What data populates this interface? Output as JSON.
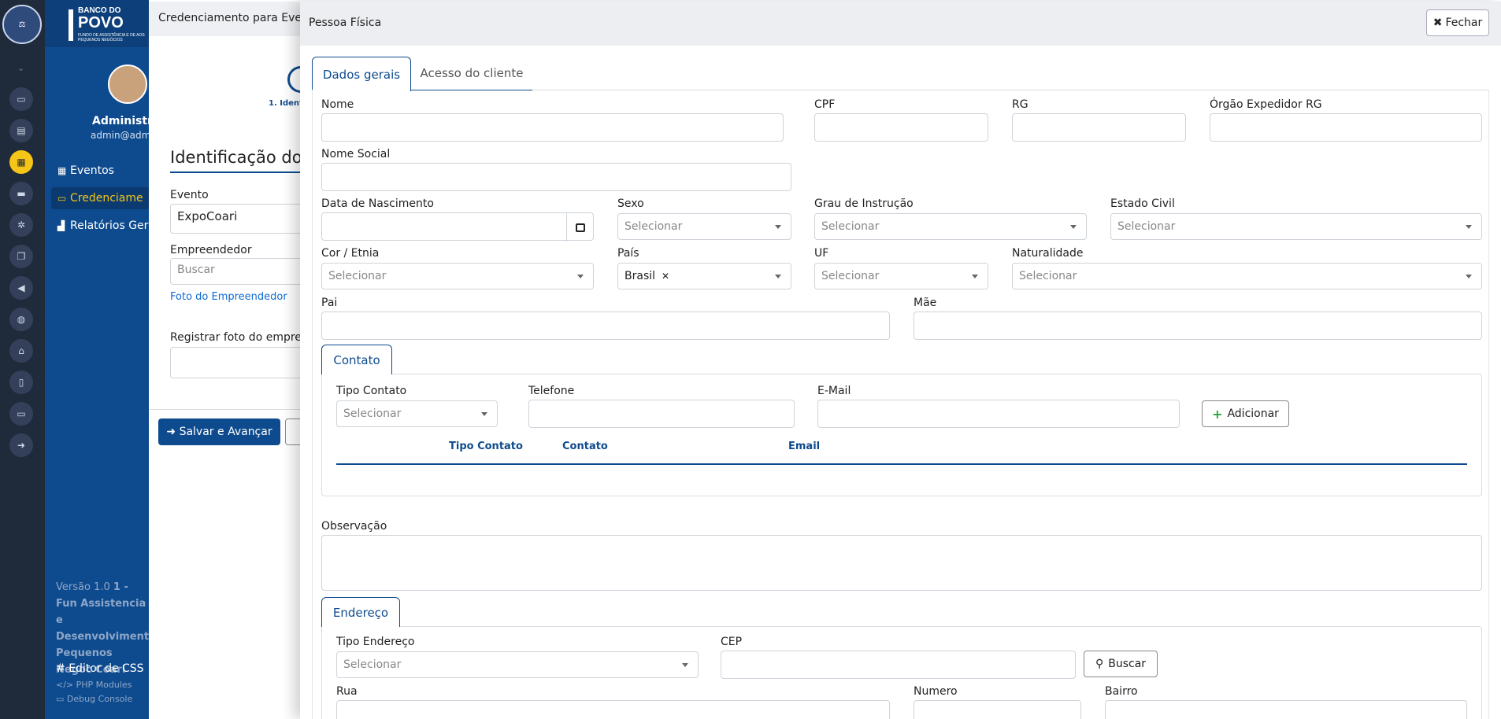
{
  "background": {
    "breadcrumb": "Credenciamento para Event",
    "step_label": "1. Ident",
    "heading": "Identificação do E",
    "evento_label": "Evento",
    "evento_value": "ExpoCoari",
    "empreendedor_label": "Empreendedor",
    "empreendedor_placeholder": "Buscar",
    "foto_link": "Foto do Empreendedor",
    "registrar_label": "Registrar foto do empree",
    "save_button": "Salvar e Avançar"
  },
  "sidebar": {
    "brand_line1": "BANCO DO",
    "brand_line2": "POVO",
    "brand_line3": "FUNDO DE ASSISTÊNCIA E DE AOS PEQUENOS NEGÓCIOS",
    "user_name": "Administra",
    "user_email": "admin@adm",
    "items": [
      {
        "label": "Eventos",
        "icon": "calendar-icon"
      },
      {
        "label": "Credenciame",
        "icon": "id-card-icon"
      },
      {
        "label": "Relatórios Ger",
        "icon": "chart-icon"
      }
    ],
    "footer_version": "Versão 1.0",
    "footer_org": "1 - Fun Assistencia e Desenvolviment Pequenos Negoc Coari",
    "editor_css": "Editor de CSS",
    "php_modules": "PHP Modules",
    "debug_console": "Debug Console"
  },
  "modal": {
    "title": "Pessoa Física",
    "close_label": "Fechar",
    "tabs": [
      {
        "label": "Dados gerais",
        "active": true
      },
      {
        "label": "Acesso do cliente",
        "active": false
      }
    ],
    "fields": {
      "nome": "Nome",
      "cpf": "CPF",
      "rg": "RG",
      "orgao": "Órgão Expedidor RG",
      "nome_social": "Nome Social",
      "nascimento": "Data de Nascimento",
      "sexo": "Sexo",
      "grau": "Grau de Instrução",
      "estado_civil": "Estado Civil",
      "cor": "Cor / Etnia",
      "pais": "País",
      "pais_value": "Brasil",
      "uf": "UF",
      "naturalidade": "Naturalidade",
      "pai": "Pai",
      "mae": "Mãe",
      "select_placeholder": "Selecionar"
    },
    "contato": {
      "tab": "Contato",
      "tipo_label": "Tipo Contato",
      "telefone_label": "Telefone",
      "email_label": "E-Mail",
      "add_button": "Adicionar",
      "columns": [
        "Tipo Contato",
        "Contato",
        "Email"
      ]
    },
    "observacao_label": "Observação",
    "endereco": {
      "tab": "Endereço",
      "tipo_label": "Tipo Endereço",
      "cep_label": "CEP",
      "buscar_button": "Buscar",
      "rua_label": "Rua",
      "numero_label": "Numero",
      "bairro_label": "Bairro"
    }
  }
}
